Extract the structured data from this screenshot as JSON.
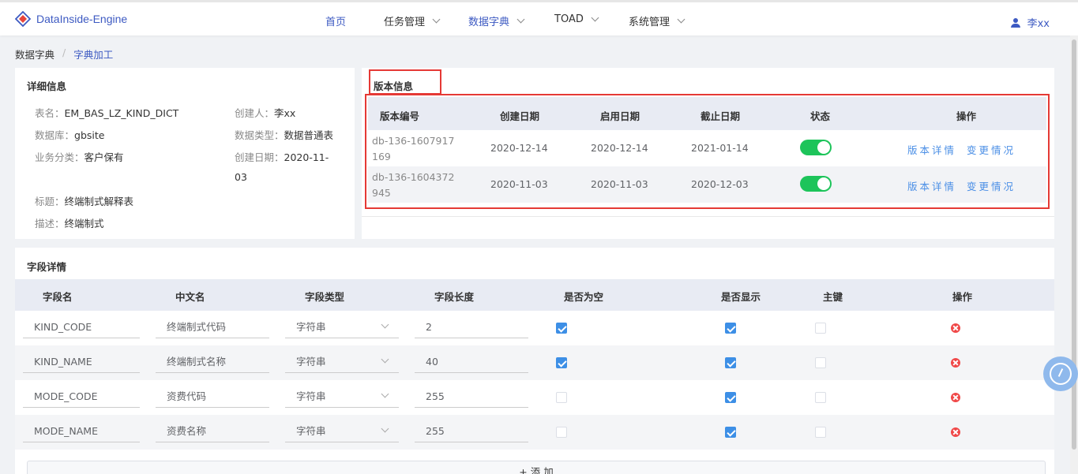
{
  "app": {
    "title": "DataInside-Engine"
  },
  "nav": {
    "items": [
      {
        "label": "首页",
        "has_dropdown": false,
        "active": false
      },
      {
        "label": "任务管理",
        "has_dropdown": true,
        "active": false
      },
      {
        "label": "数据字典",
        "has_dropdown": true,
        "active": true
      },
      {
        "label": "TOAD",
        "has_dropdown": true,
        "active": false
      },
      {
        "label": "系统管理",
        "has_dropdown": true,
        "active": false
      }
    ],
    "user": "李xx"
  },
  "breadcrumb": {
    "parent": "数据字典",
    "separator": "/",
    "current": "字典加工"
  },
  "detail": {
    "title": "详细信息",
    "table_name_label": "表名：",
    "table_name": "EM_BAS_LZ_KIND_DICT",
    "creator_label": "创建人：",
    "creator": "李xx",
    "database_label": "数据库：",
    "database": "gbsite",
    "data_type_label": "数据类型：",
    "data_type": "数据普通表",
    "biz_category_label": "业务分类：",
    "biz_category": "客户保有",
    "created_label": "创建日期：",
    "created_line1": "2020-11-",
    "created_line2": "03",
    "subject_label": "标题：",
    "subject": "终端制式解释表",
    "desc_label": "描述：",
    "desc": "终端制式"
  },
  "version": {
    "title": "版本信息",
    "headers": [
      "版本编号",
      "创建日期",
      "启用日期",
      "截止日期",
      "状态",
      "操作"
    ],
    "rows": [
      {
        "id": "db-136-1607917169",
        "created": "2020-12-14",
        "enabled": "2020-12-14",
        "deadline": "2021-01-14",
        "status_on": true,
        "detail_link": "版本详情",
        "change_link": "变更情况"
      },
      {
        "id": "db-136-1604372945",
        "created": "2020-11-03",
        "enabled": "2020-11-03",
        "deadline": "2020-12-03",
        "status_on": true,
        "detail_link": "版本详情",
        "change_link": "变更情况"
      }
    ]
  },
  "fields": {
    "title": "字段详情",
    "headers": [
      "字段名",
      "中文名",
      "字段类型",
      "字段长度",
      "是否为空",
      "是否显示",
      "主键",
      "操作"
    ],
    "rows": [
      {
        "name": "KIND_CODE",
        "cn_name": "终端制式代码",
        "type": "字符串",
        "length": "2",
        "nullable": true,
        "visible": true,
        "primary": false
      },
      {
        "name": "KIND_NAME",
        "cn_name": "终端制式名称",
        "type": "字符串",
        "length": "40",
        "nullable": true,
        "visible": true,
        "primary": false
      },
      {
        "name": "MODE_CODE",
        "cn_name": "资费代码",
        "type": "字符串",
        "length": "255",
        "nullable": false,
        "visible": true,
        "primary": false
      },
      {
        "name": "MODE_NAME",
        "cn_name": "资费名称",
        "type": "字符串",
        "length": "255",
        "nullable": false,
        "visible": true,
        "primary": false
      }
    ],
    "add_label": "+ 添 加"
  },
  "icons": {
    "logo": "diamond-logo-icon",
    "user": "user-icon",
    "dropdown": "chevron-down-icon",
    "delete": "delete-circle-icon",
    "float": "dashboard-gauge-icon"
  },
  "colors": {
    "accent": "#3d5ac2",
    "link": "#4b8fe6",
    "toggle_on": "#1dc45a",
    "highlight": "#e53935",
    "danger": "#f04848"
  }
}
